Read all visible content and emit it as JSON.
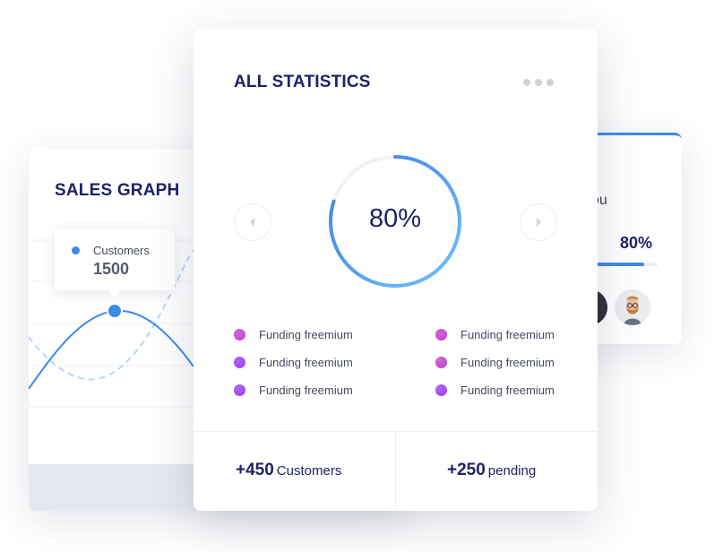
{
  "sales_graph": {
    "title": "SALES GRAPH",
    "tooltip": {
      "label": "Customers",
      "value": "1500"
    },
    "colors": {
      "primary_line": "#3e8ae6",
      "secondary_line": "#b9d6f6",
      "footer": "#e4e9f1"
    }
  },
  "right_card": {
    "label_partial": "ou",
    "percent_text": "80%",
    "progress": 0.8,
    "avatars": [
      "avatar-dark",
      "avatar-bearded-man"
    ]
  },
  "statistics": {
    "title": "ALL STATISTICS",
    "more_icon": "more-horizontal-icon",
    "prev_icon": "chevron-left-icon",
    "next_icon": "chevron-right-icon",
    "donut": {
      "value_text": "80%",
      "value": 0.8,
      "gradient": [
        "#3a7fe0",
        "#6fc0ff"
      ],
      "track": "#f1f2f4"
    },
    "legend": [
      {
        "label": "Funding freemium",
        "color": "#c13fd0"
      },
      {
        "label": "Funding freemium",
        "color": "#9b3df5"
      },
      {
        "label": "Funding freemium",
        "color": "#9b3df5"
      },
      {
        "label": "Funding freemium",
        "color": "#c13fd0"
      },
      {
        "label": "Funding freemium",
        "color": "#c13fd0"
      },
      {
        "label": "Funding freemium",
        "color": "#9b3df5"
      }
    ],
    "footer": [
      {
        "number": "+450",
        "label": "Customers"
      },
      {
        "number": "+250",
        "label": "pending"
      }
    ]
  }
}
